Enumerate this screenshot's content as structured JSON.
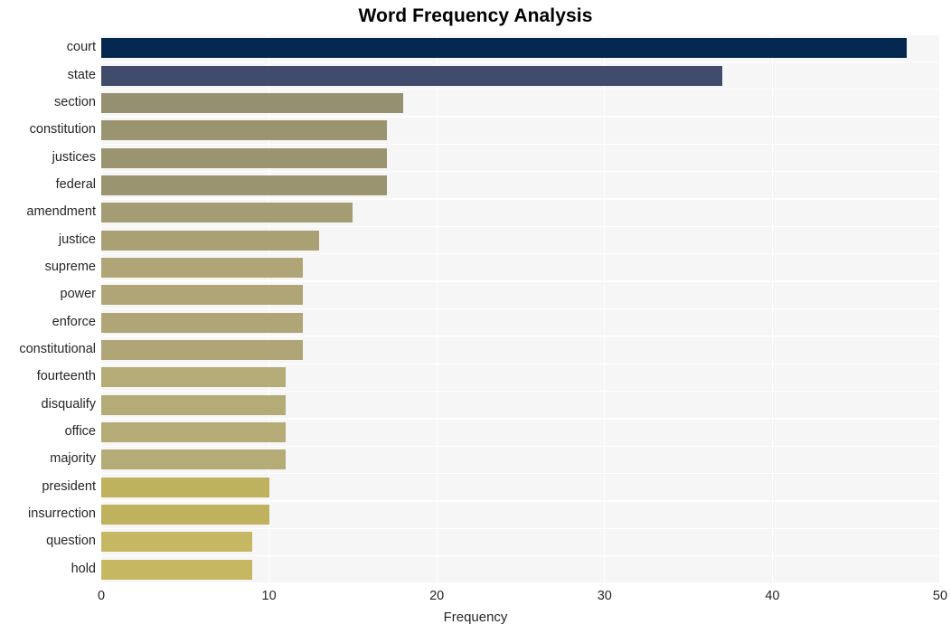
{
  "chart_data": {
    "type": "bar",
    "orientation": "horizontal",
    "title": "Word Frequency Analysis",
    "xlabel": "Frequency",
    "ylabel": "",
    "xlim": [
      0,
      50
    ],
    "xticks": [
      "0",
      "10",
      "20",
      "30",
      "40",
      "50"
    ],
    "grid": true,
    "legend": "none",
    "categories": [
      "court",
      "state",
      "section",
      "constitution",
      "justices",
      "federal",
      "amendment",
      "justice",
      "supreme",
      "power",
      "enforce",
      "constitutional",
      "fourteenth",
      "disqualify",
      "office",
      "majority",
      "president",
      "insurrection",
      "question",
      "hold"
    ],
    "values": [
      48,
      37,
      18,
      17,
      17,
      17,
      15,
      13,
      12,
      12,
      12,
      12,
      11,
      11,
      11,
      11,
      10,
      10,
      9,
      9
    ],
    "bar_colors": [
      "#042750",
      "#414b6c",
      "#95906f",
      "#9a9470",
      "#9a9470",
      "#9a9470",
      "#a49c72",
      "#a9a073",
      "#afa576",
      "#afa576",
      "#afa576",
      "#afa576",
      "#b5ab77",
      "#b5ab77",
      "#b5ab77",
      "#b5ab77",
      "#bfb25e",
      "#bfb25e",
      "#c6b762",
      "#c6b762"
    ],
    "plot_background": "#f6f6f7",
    "gridline_color": "#ffffff",
    "figure_background": "#ffffff"
  }
}
